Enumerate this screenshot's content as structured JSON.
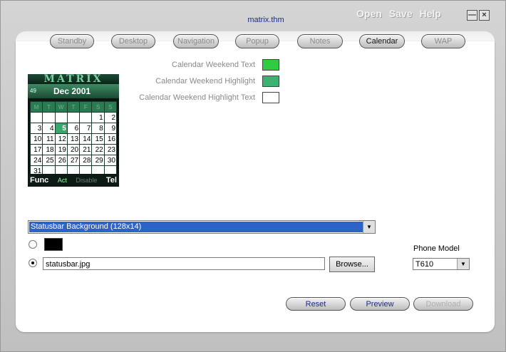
{
  "window": {
    "title": "matrix.thm"
  },
  "topmenu": [
    "Open",
    "Save",
    "Help"
  ],
  "window_controls": {
    "minimize": "—",
    "close": "×"
  },
  "tabs": [
    {
      "label": "Standby",
      "active": false
    },
    {
      "label": "Desktop",
      "active": false
    },
    {
      "label": "Navigation",
      "active": false
    },
    {
      "label": "Popup",
      "active": false
    },
    {
      "label": "Notes",
      "active": false
    },
    {
      "label": "Calendar",
      "active": true
    },
    {
      "label": "WAP",
      "active": false
    }
  ],
  "colors": [
    {
      "label": "Calendar Weekend Text",
      "color": "#2ecc40"
    },
    {
      "label": "Calendar Weekend Highlight",
      "color": "#3cb371"
    },
    {
      "label": "Calendar Weekend Highlight Text",
      "color": "#ffffff"
    }
  ],
  "phone": {
    "banner": "MATRIX",
    "week": "49",
    "month": "Dec 2001",
    "weekdays": [
      "M",
      "T",
      "W",
      "T",
      "F",
      "S",
      "S"
    ],
    "weeks": [
      [
        "",
        "",
        "",
        "",
        "",
        "1",
        "2"
      ],
      [
        "3",
        "4",
        "5",
        "6",
        "7",
        "8",
        "9"
      ],
      [
        "10",
        "11",
        "12",
        "13",
        "14",
        "15",
        "16"
      ],
      [
        "17",
        "18",
        "19",
        "20",
        "21",
        "22",
        "23"
      ],
      [
        "24",
        "25",
        "26",
        "27",
        "28",
        "29",
        "30"
      ],
      [
        "31",
        "",
        "",
        "",
        "",
        "",
        ""
      ]
    ],
    "today": "5",
    "softkeys": {
      "left": "Func",
      "mid1": "Act",
      "mid2": "Disable",
      "right": "Tel"
    }
  },
  "element_select": {
    "value": "Statusbar Background (128x14)"
  },
  "color_option": {
    "color": "#000000",
    "selected": false
  },
  "file_option": {
    "value": "statusbar.jpg",
    "selected": true
  },
  "browse_label": "Browse...",
  "phone_model": {
    "label": "Phone Model",
    "value": "T610"
  },
  "actions": {
    "reset": "Reset",
    "preview": "Preview",
    "download": "Download"
  },
  "icons": {
    "dropdown_arrow": "▼"
  }
}
